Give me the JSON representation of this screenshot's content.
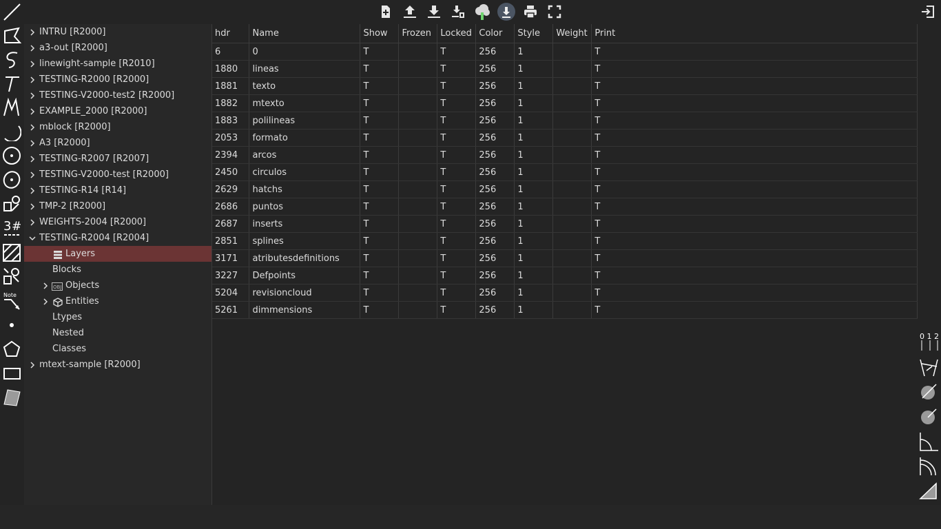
{
  "toolbar": {
    "icons": [
      "new-file-icon",
      "upload-icon",
      "download-icon",
      "export-icon",
      "cloud-icon",
      "download-circle-icon",
      "print-icon",
      "fullscreen-icon"
    ],
    "logout_icon": "logout-icon"
  },
  "left_tools": [
    "line-tool",
    "polyline-tool",
    "spline-tool",
    "text-tool",
    "mtext-tool",
    "arc-tool",
    "circle-tool",
    "ellipse-tool",
    "block-tool",
    "dimension-tool",
    "hatch-tool",
    "insert-tool",
    "leader-tool",
    "point-tool",
    "polygon-tool",
    "rectangle-tool",
    "solid-tool"
  ],
  "left_tools_labels": {
    "leader_note": "Note",
    "dimension_num": "3"
  },
  "right_tools": {
    "layers_indicator": "0 1 2",
    "dims": [
      "aligned-dim",
      "diameter-dim",
      "radius-dim",
      "angular-dim",
      "arc-length-dim",
      "ordinate-dim",
      "linear-dim"
    ]
  },
  "tree": {
    "items": [
      {
        "label": "INTRU [R2000]",
        "expanded": false
      },
      {
        "label": "a3-out [R2000]",
        "expanded": false
      },
      {
        "label": "linewight-sample [R2010]",
        "expanded": false
      },
      {
        "label": "TESTING-R2000 [R2000]",
        "expanded": false
      },
      {
        "label": "TESTING-V2000-test2 [R2000]",
        "expanded": false
      },
      {
        "label": "EXAMPLE_2000 [R2000]",
        "expanded": false
      },
      {
        "label": "mblock [R2000]",
        "expanded": false
      },
      {
        "label": "A3 [R2000]",
        "expanded": false
      },
      {
        "label": "TESTING-R2007 [R2007]",
        "expanded": false
      },
      {
        "label": "TESTING-V2000-test [R2000]",
        "expanded": false
      },
      {
        "label": "TESTING-R14 [R14]",
        "expanded": false
      },
      {
        "label": "TMP-2 [R2000]",
        "expanded": false
      },
      {
        "label": "WEIGHTS-2004 [R2000]",
        "expanded": false
      },
      {
        "label": "TESTING-R2004 [R2004]",
        "expanded": true
      },
      {
        "label": "mtext-sample [R2000]",
        "expanded": false
      }
    ],
    "children": [
      {
        "label": "Layers",
        "icon": "layers-icon",
        "selected": true
      },
      {
        "label": "Blocks"
      },
      {
        "label": "Objects",
        "icon": "obj-icon",
        "expandable": true
      },
      {
        "label": "Entities",
        "icon": "cube-icon",
        "expandable": true
      },
      {
        "label": "Ltypes"
      },
      {
        "label": "Nested"
      },
      {
        "label": "Classes"
      }
    ],
    "obj_icon_text": "OBJ"
  },
  "table": {
    "headers": [
      "hdr",
      "Name",
      "Show",
      "Frozen",
      "Locked",
      "Color",
      "Style",
      "Weight",
      "Print"
    ],
    "rows": [
      [
        "6",
        "0",
        "T",
        "",
        "T",
        "256",
        "1",
        "",
        "T"
      ],
      [
        "1880",
        "lineas",
        "T",
        "",
        "T",
        "256",
        "1",
        "",
        "T"
      ],
      [
        "1881",
        "texto",
        "T",
        "",
        "T",
        "256",
        "1",
        "",
        "T"
      ],
      [
        "1882",
        "mtexto",
        "T",
        "",
        "T",
        "256",
        "1",
        "",
        "T"
      ],
      [
        "1883",
        "polilineas",
        "T",
        "",
        "T",
        "256",
        "1",
        "",
        "T"
      ],
      [
        "2053",
        "formato",
        "T",
        "",
        "T",
        "256",
        "1",
        "",
        "T"
      ],
      [
        "2394",
        "arcos",
        "T",
        "",
        "T",
        "256",
        "1",
        "",
        "T"
      ],
      [
        "2450",
        "circulos",
        "T",
        "",
        "T",
        "256",
        "1",
        "",
        "T"
      ],
      [
        "2629",
        "hatchs",
        "T",
        "",
        "T",
        "256",
        "1",
        "",
        "T"
      ],
      [
        "2686",
        "puntos",
        "T",
        "",
        "T",
        "256",
        "1",
        "",
        "T"
      ],
      [
        "2687",
        "inserts",
        "T",
        "",
        "T",
        "256",
        "1",
        "",
        "T"
      ],
      [
        "2851",
        "splines",
        "T",
        "",
        "T",
        "256",
        "1",
        "",
        "T"
      ],
      [
        "3171",
        "atributesdefinitions",
        "T",
        "",
        "T",
        "256",
        "1",
        "",
        "T"
      ],
      [
        "3227",
        "Defpoints",
        "T",
        "",
        "T",
        "256",
        "1",
        "",
        "T"
      ],
      [
        "5204",
        "revisioncloud",
        "T",
        "",
        "T",
        "256",
        "1",
        "",
        "T"
      ],
      [
        "5261",
        "dimmensions",
        "T",
        "",
        "T",
        "256",
        "1",
        "",
        "T"
      ]
    ]
  },
  "colors": {
    "selected": "#6b3434",
    "bg": "#242424",
    "panel": "#282828",
    "cloud": "#6dd36d"
  }
}
